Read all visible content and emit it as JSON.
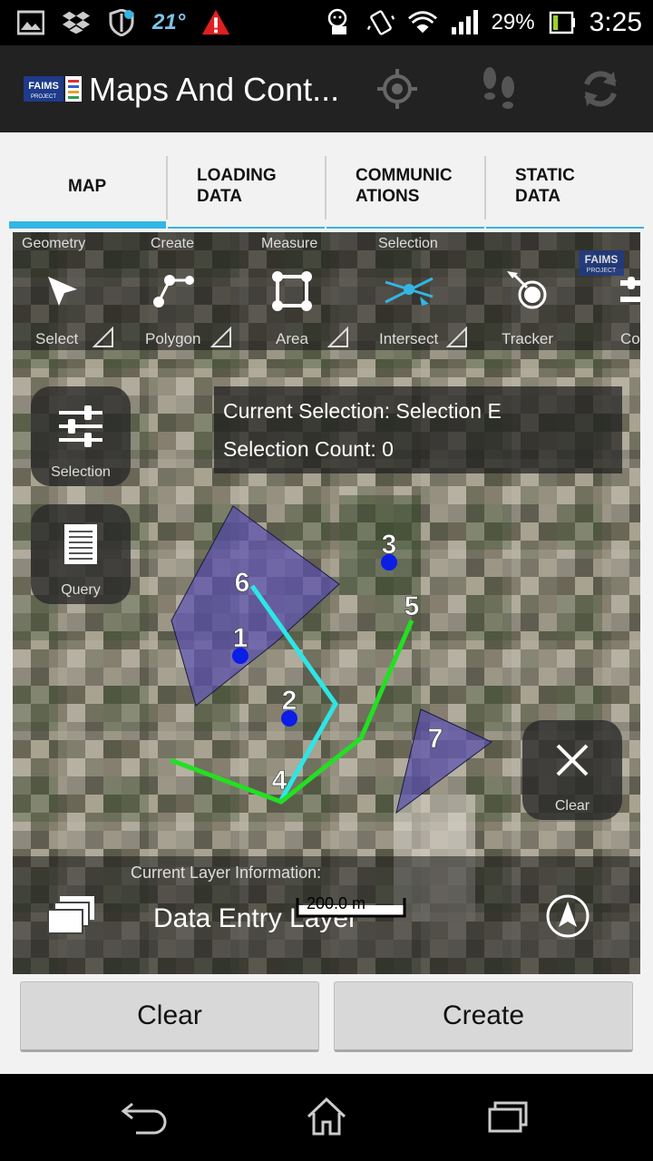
{
  "status_bar": {
    "temperature": "21°",
    "battery_percent": "29%",
    "battery_level": 0.29,
    "time": "3:25",
    "icons": [
      "image-icon",
      "dropbox-icon",
      "shield-icon",
      "warning-icon",
      "cat-icon",
      "vibrate-icon",
      "wifi-icon",
      "signal-icon",
      "battery-icon"
    ]
  },
  "action_bar": {
    "logo_text": "FAIMS",
    "logo_sub": "PROJECT",
    "title": "Maps And Cont...",
    "icons": [
      "gps-icon",
      "footsteps-icon",
      "sync-icon"
    ]
  },
  "tabs": [
    {
      "label": "MAP",
      "active": true
    },
    {
      "label": "LOADING\nDATA",
      "active": false
    },
    {
      "label": "COMMUNIC\nATIONS",
      "active": false
    },
    {
      "label": "STATIC\nDATA",
      "active": false
    }
  ],
  "toolbar": {
    "categories": [
      "Geometry",
      "Create",
      "Measure",
      "Selection"
    ],
    "tools": [
      {
        "label": "Select",
        "icon": "arrow-icon"
      },
      {
        "label": "Polygon",
        "icon": "polygon-icon"
      },
      {
        "label": "Area",
        "icon": "area-icon"
      },
      {
        "label": "Intersect",
        "icon": "intersect-icon"
      },
      {
        "label": "Tracker",
        "icon": "tracker-icon"
      },
      {
        "label": "Co",
        "icon": "config-icon"
      }
    ],
    "logo_text": "FAIMS",
    "logo_sub": "PROJECT"
  },
  "selection_info": {
    "current_selection": "Current Selection: Selection E",
    "selection_count": "Selection Count: 0"
  },
  "side_buttons": {
    "selection": "Selection",
    "query": "Query",
    "clear": "Clear"
  },
  "map_labels": [
    "1",
    "2",
    "3",
    "4",
    "5",
    "6",
    "7"
  ],
  "map_colors": {
    "polygon_fill": "#5a4fb0",
    "point": "#0a1ee6",
    "line_cyan": "#2de6e6",
    "line_green": "#22e022"
  },
  "layer_info": {
    "caption": "Current Layer Information:",
    "name": "Data Entry Layer",
    "scale": "200.0 m"
  },
  "buttons": {
    "clear": "Clear",
    "create": "Create"
  },
  "nav": [
    "back-icon",
    "home-icon",
    "recents-icon"
  ]
}
